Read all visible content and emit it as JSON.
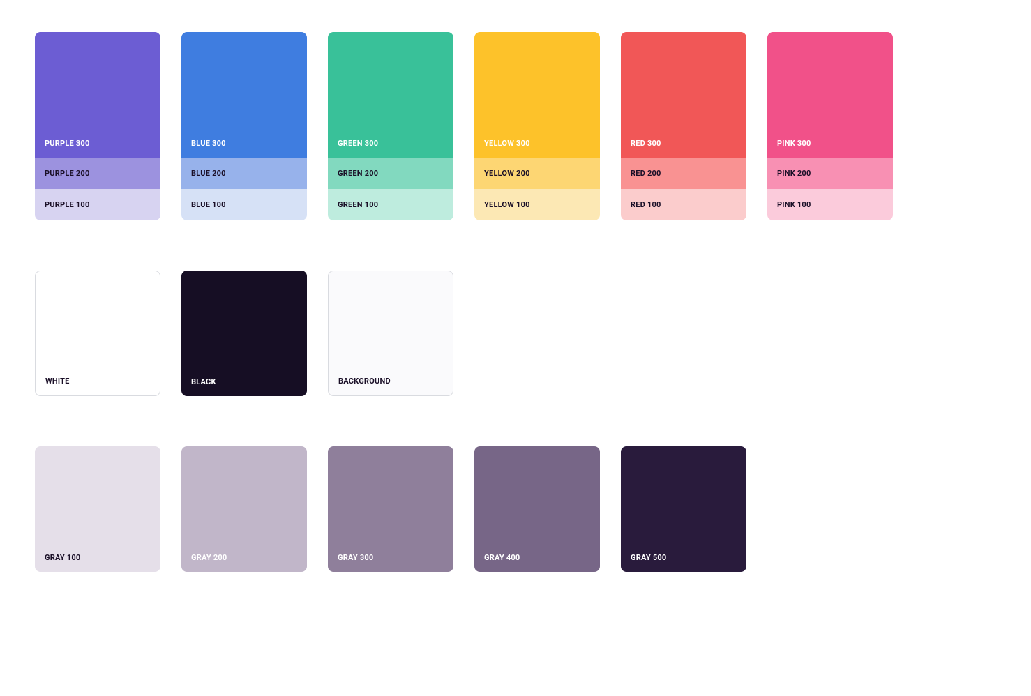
{
  "row1": [
    {
      "name": "purple",
      "shades": [
        {
          "label": "PURPLE 300",
          "hex": "#6C5DD3",
          "text": "light"
        },
        {
          "label": "PURPLE 200",
          "hex": "#9C92DF",
          "text": "dark"
        },
        {
          "label": "PURPLE 100",
          "hex": "#D7D3F1",
          "text": "dark"
        }
      ]
    },
    {
      "name": "blue",
      "shades": [
        {
          "label": "BLUE 300",
          "hex": "#3F7DE0",
          "text": "light"
        },
        {
          "label": "BLUE 200",
          "hex": "#97B2EB",
          "text": "dark"
        },
        {
          "label": "BLUE 100",
          "hex": "#D6E1F6",
          "text": "dark"
        }
      ]
    },
    {
      "name": "green",
      "shades": [
        {
          "label": "GREEN 300",
          "hex": "#39C199",
          "text": "light"
        },
        {
          "label": "GREEN 200",
          "hex": "#82D9BF",
          "text": "dark"
        },
        {
          "label": "GREEN 100",
          "hex": "#BEECDE",
          "text": "dark"
        }
      ]
    },
    {
      "name": "yellow",
      "shades": [
        {
          "label": "YELLOW 300",
          "hex": "#FDC22A",
          "text": "light"
        },
        {
          "label": "YELLOW 200",
          "hex": "#FDD673",
          "text": "dark"
        },
        {
          "label": "YELLOW 100",
          "hex": "#FCE8B4",
          "text": "dark"
        }
      ]
    },
    {
      "name": "red",
      "shades": [
        {
          "label": "RED 300",
          "hex": "#F15757",
          "text": "light"
        },
        {
          "label": "RED 200",
          "hex": "#F99292",
          "text": "dark"
        },
        {
          "label": "RED 100",
          "hex": "#FBCCCC",
          "text": "dark"
        }
      ]
    },
    {
      "name": "pink",
      "shades": [
        {
          "label": "PINK 300",
          "hex": "#F15189",
          "text": "light"
        },
        {
          "label": "PINK 200",
          "hex": "#F890B3",
          "text": "dark"
        },
        {
          "label": "PINK 100",
          "hex": "#FBCBDB",
          "text": "dark"
        }
      ]
    }
  ],
  "row2": [
    {
      "name": "white",
      "label": "WHITE",
      "hex": "#FFFFFF",
      "text": "dark",
      "border": true
    },
    {
      "name": "black",
      "label": "BLACK",
      "hex": "#160E24",
      "text": "light",
      "border": false
    },
    {
      "name": "background",
      "label": "BACKGROUND",
      "hex": "#FAFAFC",
      "text": "dark",
      "border": true
    }
  ],
  "row3": [
    {
      "name": "gray-100",
      "label": "GRAY 100",
      "hex": "#E5DFE9",
      "text": "dark"
    },
    {
      "name": "gray-200",
      "label": "GRAY 200",
      "hex": "#C1B6C9",
      "text": "light"
    },
    {
      "name": "gray-300",
      "label": "GRAY 300",
      "hex": "#8F7F9B",
      "text": "light"
    },
    {
      "name": "gray-400",
      "label": "GRAY 400",
      "hex": "#776687",
      "text": "light"
    },
    {
      "name": "gray-500",
      "label": "GRAY 500",
      "hex": "#291B3C",
      "text": "light"
    }
  ]
}
